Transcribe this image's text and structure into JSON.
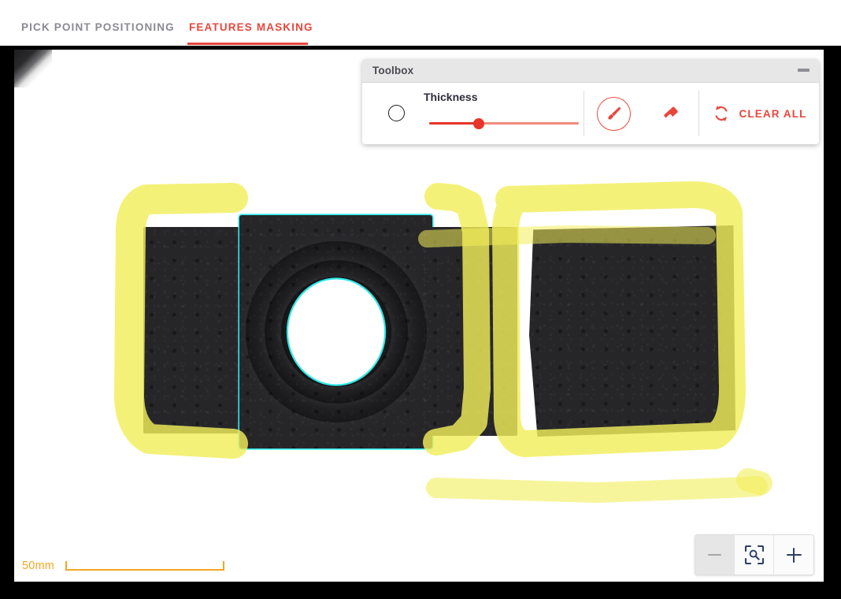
{
  "tabs": [
    {
      "id": "pick-point-positioning",
      "label": "PICK POINT POSITIONING",
      "active": false
    },
    {
      "id": "features-masking",
      "label": "FEATURES MASKING",
      "active": true
    }
  ],
  "toolbox": {
    "title": "Toolbox",
    "minimize_icon": "minimize-icon",
    "thickness_label": "Thickness",
    "thickness_value": 33,
    "thickness_min": 0,
    "thickness_max": 100,
    "brush_preview_icon": "brush-size-circle-icon",
    "brush_tool_icon": "paintbrush-icon",
    "brush_tool_active": true,
    "eraser_tool_icon": "eraser-icon",
    "eraser_tool_active": false,
    "clear_all_icon": "refresh-icon",
    "clear_all_label": "CLEAR ALL"
  },
  "canvas": {
    "scale_bar": {
      "label": "50mm",
      "icon": "ruler-icon"
    },
    "detected_contour_color": "#2ee8e8",
    "mask_color": "#f2ee5a",
    "part_color": "#262629",
    "background_color": "#ffffff"
  },
  "zoom_controls": {
    "zoom_out_icon": "minus-icon",
    "zoom_out_enabled": false,
    "fit_to_view_icon": "fit-to-screen-magnifier-icon",
    "zoom_in_icon": "plus-icon",
    "zoom_in_enabled": true
  },
  "colors": {
    "accent_red": "#e8463c",
    "tab_inactive": "#8a8a92",
    "scale_orange": "#f5a623",
    "contour_cyan": "#2ee8e8",
    "mask_yellow": "#f2ee5a",
    "zoom_icon_navy": "#2c3e63"
  }
}
